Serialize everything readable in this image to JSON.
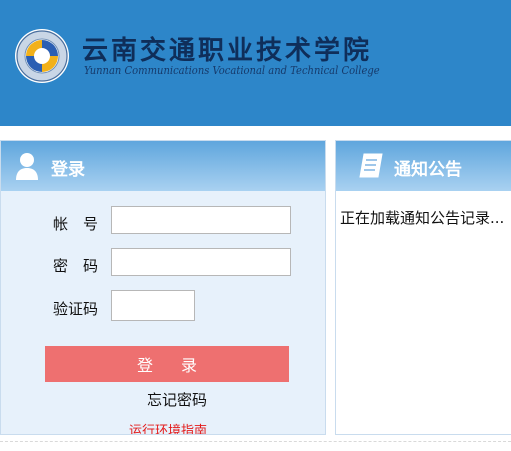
{
  "header": {
    "logo_icon": "college-emblem-icon",
    "name_cn": "云南交通职业技术学院",
    "name_en": "Yunnan Communications Vocational and Technical College",
    "bg_color": "#2d86c9"
  },
  "login": {
    "title": "登录",
    "icon": "user-icon",
    "account_label": "帐　号",
    "account_value": "",
    "password_label": "密　码",
    "password_value": "",
    "captcha_label": "验证码",
    "captcha_value": "",
    "login_button": "登录",
    "forgot_password": "忘记密码",
    "env_guide": "运行环境指南",
    "button_color": "#ee7070",
    "guide_color": "#e31b1b"
  },
  "notice": {
    "title": "通知公告",
    "icon": "scroll-icon",
    "loading_text": "正在加载通知公告记录..."
  }
}
